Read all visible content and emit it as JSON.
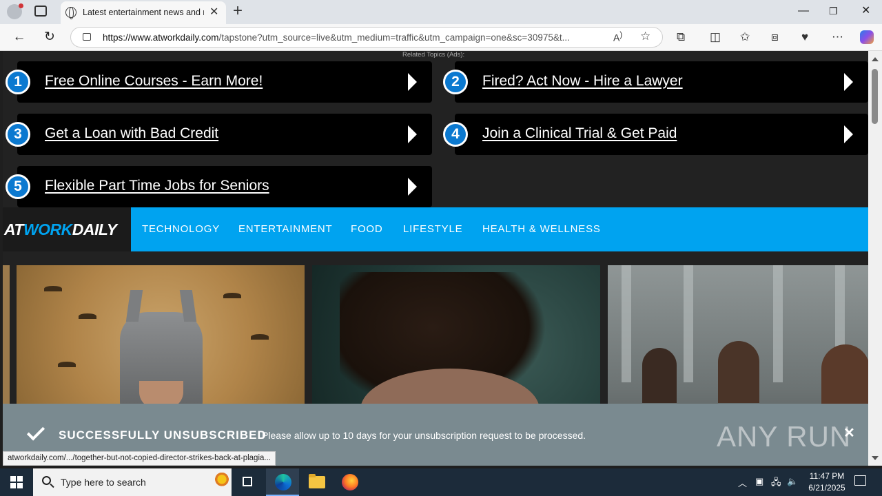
{
  "browser": {
    "tab_title": "Latest entertainment news and re",
    "url_host": "https://www.atworkdaily.com",
    "url_rest": "/tapstone?utm_source=live&utm_medium=traffic&utm_campaign=one&sc=30975&t..."
  },
  "ads": {
    "heading": "Related Topics (Ads):",
    "items": [
      {
        "num": "1",
        "label": "Free Online Courses - Earn More!"
      },
      {
        "num": "2",
        "label": "Fired? Act Now - Hire a Lawyer"
      },
      {
        "num": "3",
        "label": "Get a Loan with Bad Credit"
      },
      {
        "num": "4",
        "label": "Join a Clinical Trial & Get Paid"
      },
      {
        "num": "5",
        "label": "Flexible Part Time Jobs for Seniors"
      }
    ]
  },
  "site": {
    "logo_part1": "AT",
    "logo_part2": "WORK",
    "logo_part3": "DAILY",
    "nav": [
      "TECHNOLOGY",
      "ENTERTAINMENT",
      "FOOD",
      "LIFESTYLE",
      "HEALTH & WELLNESS"
    ],
    "accent_color": "#00a3f0"
  },
  "notice": {
    "title": "SUCCESSFULLY UNSUBSCRIBED",
    "message": "Please allow up to 10 days for your unsubscription request to be processed.",
    "watermark": "ANY RUN"
  },
  "status_link": "atworkdaily.com/.../together-but-not-copied-director-strikes-back-at-plagia...",
  "taskbar": {
    "search_placeholder": "Type here to search",
    "time": "11:47 PM",
    "date": "6/21/2025"
  }
}
